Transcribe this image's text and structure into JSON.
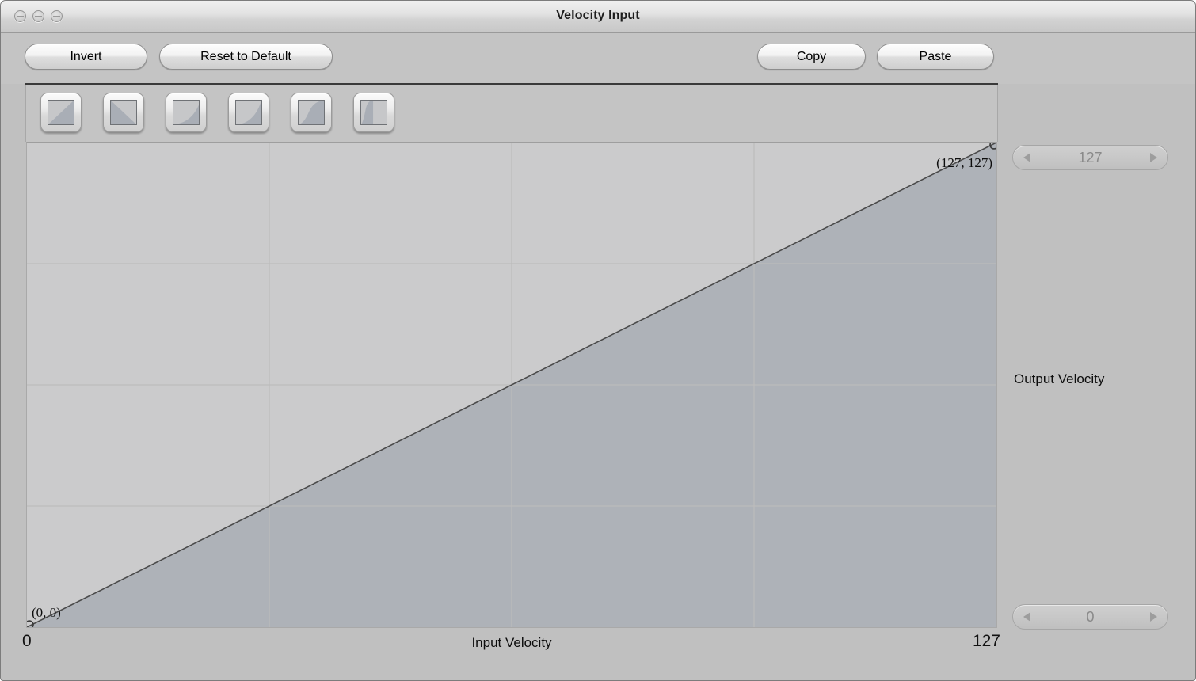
{
  "window": {
    "title": "Velocity Input",
    "traffic_lights": [
      "close",
      "minimize",
      "zoom"
    ]
  },
  "toolbar": {
    "invert_label": "Invert",
    "reset_label": "Reset to Default",
    "copy_label": "Copy",
    "paste_label": "Paste"
  },
  "presets": [
    {
      "name": "linear-rising-curve-preset",
      "shape": "linear"
    },
    {
      "name": "linear-alt-curve-preset",
      "shape": "linear-alt"
    },
    {
      "name": "concave-soft-curve-preset",
      "shape": "concave-soft"
    },
    {
      "name": "concave-hard-curve-preset",
      "shape": "concave-hard"
    },
    {
      "name": "s-curve-preset",
      "shape": "s-curve"
    },
    {
      "name": "convex-curve-preset",
      "shape": "convex"
    }
  ],
  "graph": {
    "point_max_label": "(127, 127)",
    "point_min_label": "(0, 0)",
    "x_axis_min": "0",
    "x_axis_title": "Input Velocity",
    "x_axis_max": "127",
    "y_axis_title": "Output Velocity",
    "grid_columns": 4,
    "grid_rows": 4,
    "fill_color": "#aeb2b8",
    "line_color": "#4a4a4a",
    "background_color": "#cbcbcc",
    "grid_color": "#bcbcbc"
  },
  "steppers": {
    "top_value": "127",
    "bottom_value": "0",
    "decrement_icon": "triangle-left-icon",
    "increment_icon": "triangle-right-icon"
  },
  "chart_data": {
    "type": "line",
    "title": "Velocity Input",
    "xlabel": "Input Velocity",
    "ylabel": "Output Velocity",
    "xlim": [
      0,
      127
    ],
    "ylim": [
      0,
      127
    ],
    "xticks": [
      0,
      127
    ],
    "yticks": [
      0,
      127
    ],
    "grid": true,
    "grid_columns": 4,
    "grid_rows": 4,
    "legend": "none",
    "series": [
      {
        "name": "velocity-curve",
        "filled": true,
        "x": [
          0,
          127
        ],
        "y": [
          0,
          127
        ],
        "points": [
          {
            "x": 0,
            "y": 0,
            "label": "(0, 0)",
            "handle": true
          },
          {
            "x": 127,
            "y": 127,
            "label": "(127, 127)",
            "handle": true
          }
        ]
      }
    ],
    "annotations": [
      "(0, 0)",
      "(127, 127)"
    ]
  }
}
